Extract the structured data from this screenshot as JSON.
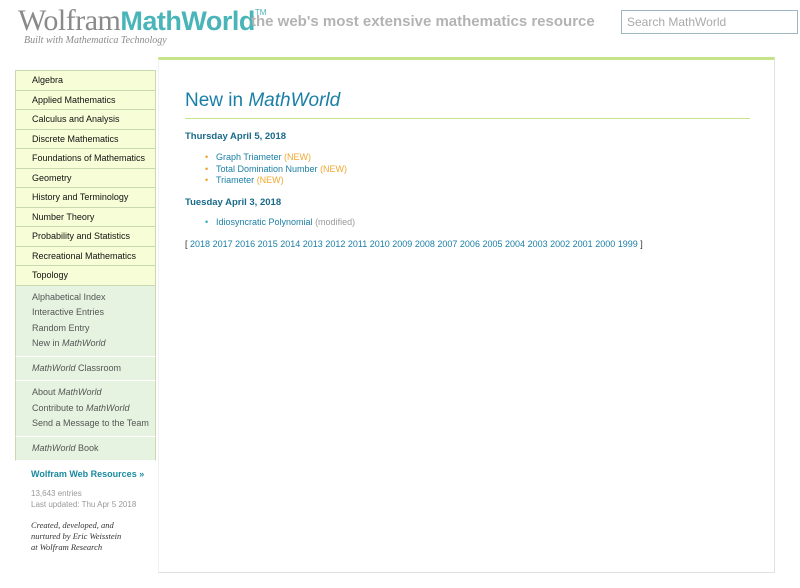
{
  "header": {
    "logo_wolfram": "Wolfram",
    "logo_mathworld": "MathWorld",
    "logo_tm": "TM",
    "logo_sub": "Built with Mathematica Technology",
    "tagline": "the web's most extensive mathematics resource",
    "search_placeholder": "Search MathWorld"
  },
  "sidebar": {
    "topics": [
      "Algebra",
      "Applied Mathematics",
      "Calculus and Analysis",
      "Discrete Mathematics",
      "Foundations of Mathematics",
      "Geometry",
      "History and Terminology",
      "Number Theory",
      "Probability and Statistics",
      "Recreational Mathematics",
      "Topology"
    ],
    "browse": {
      "alphabetical": "Alphabetical Index",
      "interactive": "Interactive Entries",
      "random": "Random Entry",
      "new_prefix": "New in ",
      "new_italic": "MathWorld"
    },
    "classroom": {
      "italic": "MathWorld",
      "rest": " Classroom"
    },
    "about": {
      "about_prefix": "About ",
      "about_italic": "MathWorld",
      "contribute_prefix": "Contribute to ",
      "contribute_italic": "MathWorld",
      "message": "Send a Message to the Team"
    },
    "book": {
      "italic": "MathWorld",
      "rest": " Book"
    },
    "web_resources": "Wolfram Web Resources »",
    "entries_count": "13,643 entries",
    "last_updated": "Last updated: Thu Apr 5 2018",
    "credit": [
      "Created, developed, and",
      "nurtured by Eric Weisstein",
      "at Wolfram Research"
    ]
  },
  "main": {
    "title_prefix": "New in ",
    "title_italic": "MathWorld",
    "sections": [
      {
        "date": "Thursday April 5, 2018",
        "items": [
          {
            "name": "Graph Triameter",
            "tag": "(NEW)"
          },
          {
            "name": "Total Domination Number",
            "tag": "(NEW)"
          },
          {
            "name": "Triameter",
            "tag": "(NEW)"
          }
        ]
      },
      {
        "date": "Tuesday April 3, 2018",
        "items": [
          {
            "name": "Idiosyncratic Polynomial",
            "tag": "(modified)"
          }
        ]
      }
    ],
    "years_open": "[",
    "years_close": "]",
    "years": [
      "2018",
      "2017",
      "2016",
      "2015",
      "2014",
      "2013",
      "2012",
      "2011",
      "2010",
      "2009",
      "2008",
      "2007",
      "2006",
      "2005",
      "2004",
      "2003",
      "2002",
      "2001",
      "2000",
      "1999"
    ]
  },
  "colors": {
    "accent_teal": "#1a7fa6",
    "logo_teal": "#49b5b9",
    "topic_bg": "#f7fdd6",
    "group_bg": "#e5f3e0",
    "rule_green": "#c5e48a",
    "new_orange": "#f0a830"
  }
}
